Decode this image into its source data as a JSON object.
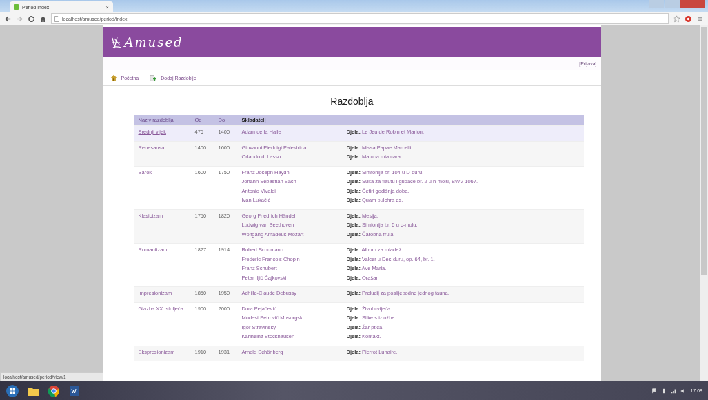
{
  "browser": {
    "tab_title": "Period Index",
    "tab_close": "×",
    "url": "localhost/amused/period/index",
    "status_url": "localhost/amused/period/view/1"
  },
  "site": {
    "logo": "Amused",
    "login": "[Prijava]",
    "nav": [
      {
        "label": "Početna",
        "kind": "home"
      },
      {
        "label": "Dodaj Razdoblje",
        "kind": "add"
      }
    ]
  },
  "page_title": "Razdoblja",
  "table": {
    "columns": [
      "Naziv razdoblja",
      "Od",
      "Do",
      "Skladatelj"
    ],
    "rows": [
      {
        "name": "Srednji vijek",
        "from": "476",
        "to": "1400",
        "selected": true,
        "composers": [
          "Adam de la Halle"
        ],
        "works": [
          "**Djela:** Le Jeu de Robin et Marion."
        ]
      },
      {
        "name": "Renesansa",
        "from": "1400",
        "to": "1600",
        "selected": false,
        "composers": [
          "Giovanni Pierluigi Palestrina",
          "Orlando di Lasso"
        ],
        "works": [
          "**Djela:** Missa Papae Marcelli.",
          "**Djela:** Matona mia cara."
        ]
      },
      {
        "name": "Barok",
        "from": "1600",
        "to": "1750",
        "selected": false,
        "composers": [
          "Franz Joseph Haydn",
          "Johann Sebastian Bach",
          "Antonio Vivaldi",
          "Ivan Lukačić"
        ],
        "works": [
          "**Djela:** Simfonija br. 104 u D-duru.",
          "**Djela:** Suita za flautu i gudače br. 2 u h-molu, BWV 1067.",
          "**Djela:** Četiri godišnja doba.",
          "**Djela:** Quam pulchra es."
        ]
      },
      {
        "name": "Klasicizam",
        "from": "1750",
        "to": "1820",
        "selected": false,
        "composers": [
          "Georg Friedrich Händel",
          "Ludwig van Beethoven",
          "Wolfgang Amadeus Mozart"
        ],
        "works": [
          "**Djela:** Mesija.",
          "**Djela:** Simfonija br. 5 u c-molu.",
          "**Djela:** Čarobna frula."
        ]
      },
      {
        "name": "Romantizam",
        "from": "1827",
        "to": "1914",
        "selected": false,
        "composers": [
          "Robert Schumann",
          "Frederic Francois Chopin",
          "Franz Schubert",
          "Petar Iljič Čajkovski"
        ],
        "works": [
          "**Djela:** Album za mladež.",
          "**Djela:** Valcer u Des-duru, op. 64, br. 1.",
          "**Djela:** Ave Maria.",
          "**Djela:** Orašar."
        ]
      },
      {
        "name": "Impresionizam",
        "from": "1850",
        "to": "1950",
        "selected": false,
        "composers": [
          "Achille-Claude Debussy"
        ],
        "works": [
          "**Djela:** Preludij za poslijepodne jednog fauna."
        ]
      },
      {
        "name": "Glazba XX. stoljeća",
        "from": "1900",
        "to": "2000",
        "selected": false,
        "composers": [
          "Dora Pejačević",
          "Modest Petrovič Musorgski",
          "Igor Stravinsky",
          "Karlheinz Stockhausen"
        ],
        "works": [
          "**Djela:** Život cvijeća.",
          "**Djela:** Slike s izložbe.",
          "**Djela:** Žar ptica.",
          "**Djela:** Kontakt."
        ]
      },
      {
        "name": "Ekspresionizam",
        "from": "1910",
        "to": "1931",
        "selected": false,
        "composers": [
          "Arnold Schönberg"
        ],
        "works": [
          "**Djela:** Pierrot Lunaire."
        ]
      }
    ]
  },
  "taskbar": {
    "clock": "17:08"
  }
}
